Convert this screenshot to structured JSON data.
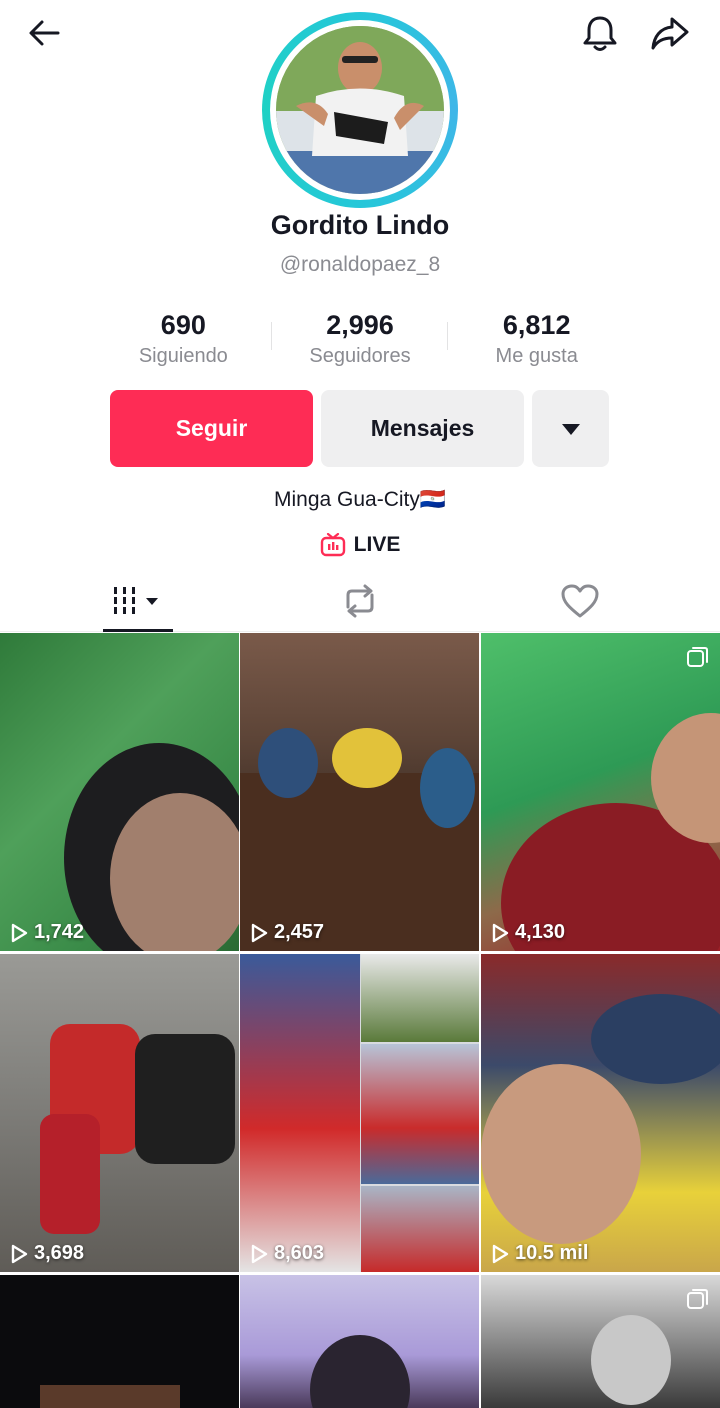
{
  "header": {
    "back_icon": "arrow-left-icon",
    "bell_icon": "bell-icon",
    "share_icon": "share-icon"
  },
  "profile": {
    "display_name": "Gordito Lindo",
    "username": "@ronaldopaez_8",
    "bio": "Minga Gua-City🇵🇾",
    "live_label": "LIVE"
  },
  "stats": [
    {
      "value": "690",
      "label": "Siguiendo"
    },
    {
      "value": "2,996",
      "label": "Seguidores"
    },
    {
      "value": "6,812",
      "label": "Me gusta"
    }
  ],
  "actions": {
    "follow_label": "Seguir",
    "message_label": "Mensajes"
  },
  "tabs": [
    {
      "name": "videos",
      "icon": "grid-icon",
      "selected": true
    },
    {
      "name": "reposts",
      "icon": "repost-icon",
      "selected": false
    },
    {
      "name": "liked",
      "icon": "heart-icon",
      "selected": false
    }
  ],
  "videos": [
    {
      "views": "1,742"
    },
    {
      "views": "2,457"
    },
    {
      "views": "4,130"
    },
    {
      "views": "3,698"
    },
    {
      "views": "8,603"
    },
    {
      "views": "10.5 mil"
    }
  ],
  "colors": {
    "accent": "#fe2c55",
    "ring": "#25c7d9",
    "muted": "#8a8b91",
    "button_gray": "#efeff0"
  }
}
